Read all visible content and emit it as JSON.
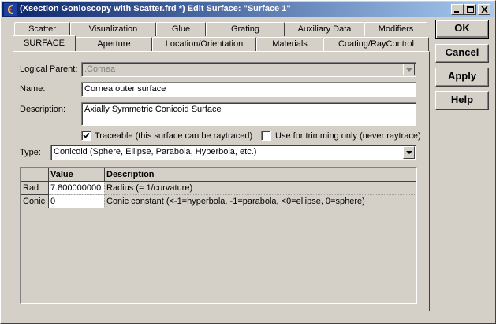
{
  "window": {
    "title": "(Xsection Gonioscopy with Scatter.frd *) Edit Surface: \"Surface 1\""
  },
  "tabs_back": [
    "Scatter",
    "Visualization",
    "Glue",
    "Grating",
    "Auxiliary Data",
    "Modifiers"
  ],
  "tabs_front": [
    "SURFACE",
    "Aperture",
    "Location/Orientation",
    "Materials",
    "Coating/RayControl"
  ],
  "active_tab": "SURFACE",
  "form": {
    "logical_parent_label": "Logical Parent:",
    "logical_parent_value": ".Cornea",
    "name_label": "Name:",
    "name_value": "Cornea outer surface",
    "description_label": "Description:",
    "description_value": "Axially Symmetric Conicoid Surface",
    "traceable_label": "Traceable (this surface can be raytraced)",
    "traceable_checked": true,
    "trimming_label": "Use for trimming only (never raytrace)",
    "trimming_checked": false,
    "type_label": "Type:",
    "type_value": "Conicoid   (Sphere, Ellipse, Parabola, Hyperbola, etc.)"
  },
  "grid": {
    "headers": [
      "",
      "Value",
      "Description"
    ],
    "rows": [
      {
        "name": "Rad",
        "value": "7.800000000",
        "description": "Radius   (= 1/curvature)"
      },
      {
        "name": "Conic",
        "value": "0",
        "description": "Conic constant (<-1=hyperbola, -1=parabola, <0=ellipse, 0=sphere)"
      }
    ]
  },
  "buttons": {
    "ok": "OK",
    "cancel": "Cancel",
    "apply": "Apply",
    "help": "Help"
  }
}
